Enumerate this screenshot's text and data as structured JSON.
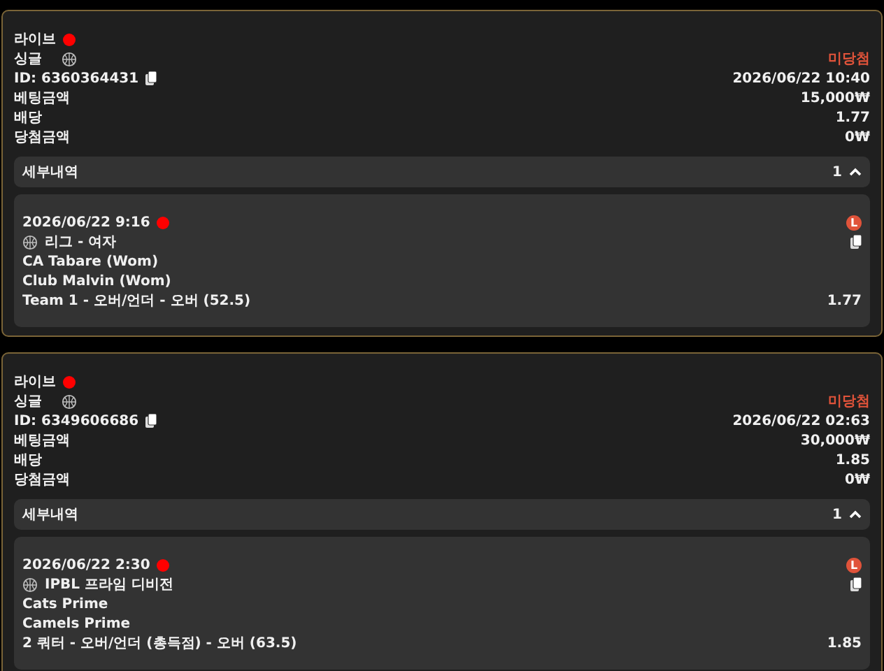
{
  "bets": [
    {
      "mode": "라이브",
      "live": true,
      "type": "싱글",
      "status": "미당첨",
      "id": "ID: 6360364431",
      "placed": "2026/06/22 10:40",
      "rows": [
        {
          "label": "베팅금액",
          "value": "15,000₩"
        },
        {
          "label": "배당",
          "value": "1.77"
        },
        {
          "label": "당첨금액",
          "value": "0₩"
        }
      ],
      "details": {
        "label": "세부내역",
        "count": "1",
        "expanded": true,
        "selections": [
          {
            "time": "2026/06/22 9:16",
            "live": true,
            "badge": "L",
            "league": "리그 - 여자",
            "home": "CA Tabare (Wom)",
            "away": "Club Malvin (Wom)",
            "market": "Team 1 - 오버/언더 - 오버 (52.5)",
            "odds": "1.77"
          }
        ]
      }
    },
    {
      "mode": "라이브",
      "live": true,
      "type": "싱글",
      "status": "미당첨",
      "id": "ID: 6349606686",
      "placed": "2026/06/22 02:63",
      "rows": [
        {
          "label": "베팅금액",
          "value": "30,000₩"
        },
        {
          "label": "배당",
          "value": "1.85"
        },
        {
          "label": "당첨금액",
          "value": "0₩"
        }
      ],
      "details": {
        "label": "세부내역",
        "count": "1",
        "expanded": true,
        "selections": [
          {
            "time": "2026/06/22 2:30",
            "live": true,
            "badge": "L",
            "league": "IPBL 프라임 디비전",
            "home": "Cats Prime",
            "away": "Camels Prime",
            "market": "2 쿼터 - 오버/언더 (총득점) - 오버 (63.5)",
            "odds": "1.85"
          }
        ]
      }
    }
  ]
}
